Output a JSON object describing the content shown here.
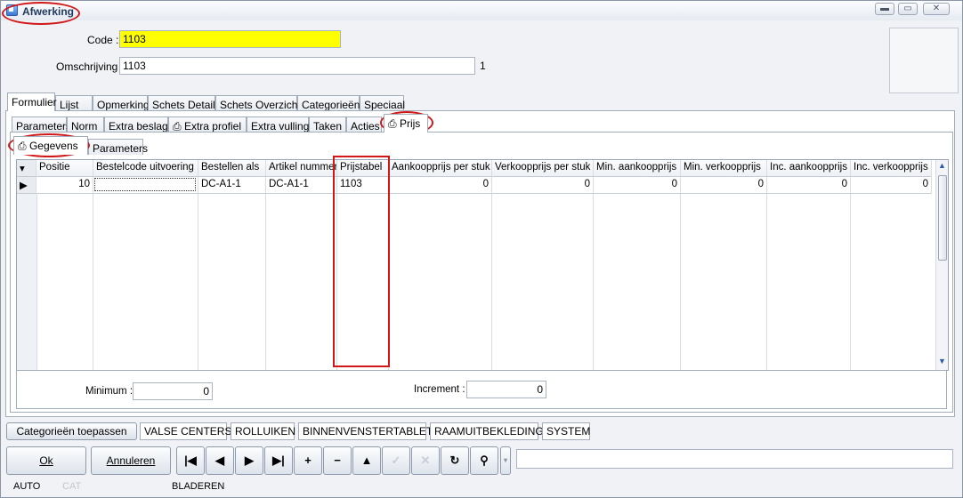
{
  "window": {
    "title": "Afwerking",
    "controls": [
      "minimize",
      "maximize",
      "close"
    ]
  },
  "form": {
    "code_label": "Code :",
    "code_value": "1103",
    "code_color": "#ffff00",
    "omschrijving_label": "Omschrijving :",
    "omschrijving_value": "1103",
    "omschrijving_count": "1"
  },
  "main_tabs": [
    "Formulier",
    "Lijst",
    "Opmerking",
    "Schets Detail",
    "Schets Overzicht",
    "Categorieën",
    "Speciaal"
  ],
  "sub_tabs": [
    "Parameters",
    "Norm",
    "Extra beslag",
    "Extra profiel",
    "Extra vulling",
    "Taken",
    "Acties",
    "Prijs"
  ],
  "inner_tabs": [
    "Gegevens",
    "Parameters"
  ],
  "grid": {
    "columns": [
      "Positie",
      "Bestelcode uitvoering",
      "Bestellen als",
      "Artikel nummer",
      "Prijstabel",
      "Aankoopprijs per stuk",
      "Verkoopprijs per stuk",
      "Min. aankoopprijs",
      "Min. verkoopprijs",
      "Inc. aankoopprijs",
      "Inc. verkoopprijs"
    ],
    "rows": [
      {
        "positie": "10",
        "bestelcode": "",
        "bestellen_als": "DC-A1-1",
        "artikel_nummer": "DC-A1-1",
        "prijstabel": "1103",
        "aankoopprijs": "0",
        "verkoopprijs": "0",
        "min_aankoop": "0",
        "min_verkoop": "0",
        "inc_aankoop": "0",
        "inc_verkoop": "0"
      }
    ]
  },
  "limits": {
    "minimum_label": "Minimum :",
    "minimum_value": "0",
    "increment_label": "Increment :",
    "increment_value": "0"
  },
  "categories": {
    "apply_button": "Categorieën toepassen",
    "items": [
      "VALSE CENTERS",
      "ROLLUIKEN",
      "BINNENVENSTERTABLET",
      "RAAMUITBEKLEDING",
      "SYSTEM"
    ]
  },
  "actions": {
    "ok": "Ok",
    "cancel": "Annuleren"
  },
  "nav_icons": [
    "first-record-icon",
    "prev-record-icon",
    "next-record-icon",
    "last-record-icon",
    "add-icon",
    "remove-icon",
    "up-icon",
    "confirm-icon",
    "cancel-edit-icon",
    "refresh-icon",
    "search-icon"
  ],
  "status": {
    "mode": "AUTO",
    "cat": "CAT",
    "state": "BLADEREN"
  },
  "colors": {
    "highlight_red": "#d01818",
    "title_blue": "#1e395b"
  }
}
